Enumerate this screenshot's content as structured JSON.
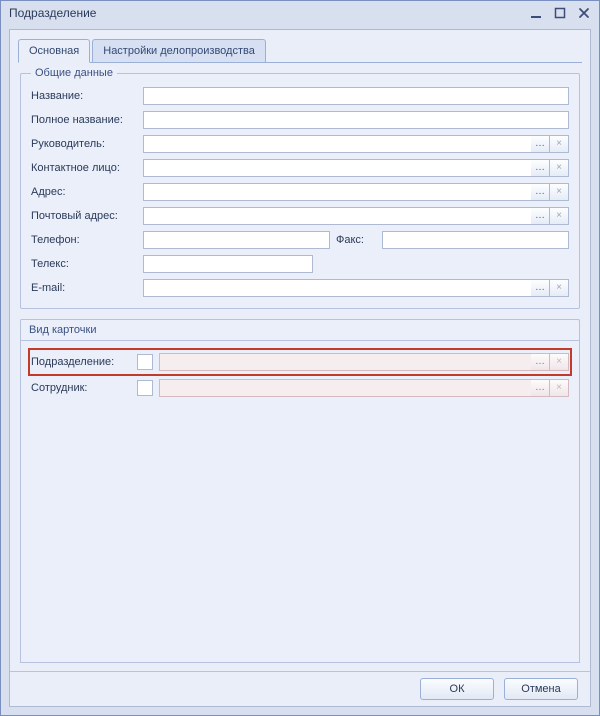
{
  "window": {
    "title": "Подразделение"
  },
  "tabs": {
    "main": "Основная",
    "settings": "Настройки делопроизводства"
  },
  "group_general": {
    "title": "Общие данные",
    "name_label": "Название:",
    "fullname_label": "Полное название:",
    "manager_label": "Руководитель:",
    "contact_label": "Контактное лицо:",
    "address_label": "Адрес:",
    "postal_label": "Почтовый адрес:",
    "phone_label": "Телефон:",
    "fax_label": "Факс:",
    "telex_label": "Телекс:",
    "email_label": "E-mail:",
    "name_value": "",
    "fullname_value": "",
    "manager_value": "",
    "contact_value": "",
    "address_value": "",
    "postal_value": "",
    "phone_value": "",
    "fax_value": "",
    "telex_value": "",
    "email_value": ""
  },
  "group_cardkind": {
    "title": "Вид карточки",
    "dept_label": "Подразделение:",
    "employee_label": "Сотрудник:",
    "dept_value": "",
    "employee_value": ""
  },
  "buttons": {
    "ok": "ОК",
    "cancel": "Отмена"
  },
  "glyphs": {
    "dots": "…",
    "clear": "×"
  }
}
